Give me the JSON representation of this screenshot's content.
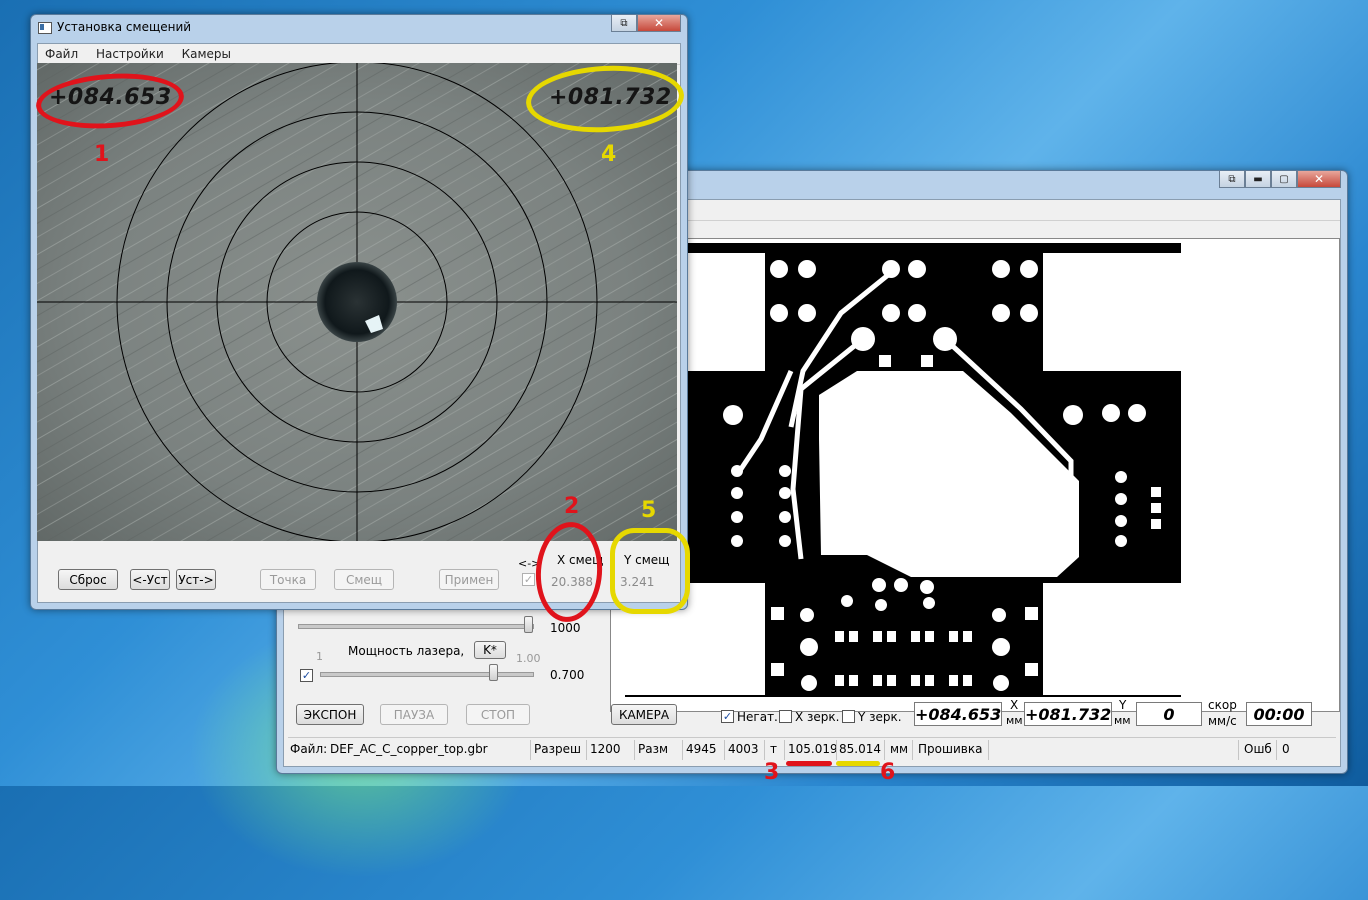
{
  "front_window": {
    "title": "Установка смещений",
    "menu": [
      "Файл",
      "Настройки",
      "Камеры"
    ],
    "camera": {
      "x_value": "+084.653",
      "y_value": "+081.732"
    },
    "buttons": {
      "reset": "Сброс",
      "set_left": "<-Уст",
      "set_right": "Уст->",
      "point": "Точка",
      "offset": "Смещ",
      "apply": "Примен"
    },
    "arrow_label": "<->",
    "x_offset": {
      "label": "X смещ",
      "value": "20.388"
    },
    "y_offset": {
      "label": "Y смещ",
      "value": "3.241"
    }
  },
  "back_window": {
    "slider1": {
      "max_label": "",
      "value": "1000"
    },
    "laser": {
      "label": "Мощность лазера,",
      "k_button": "K*",
      "min_label": "1",
      "max_label": "1.00",
      "value": "0.700"
    },
    "buttons": {
      "expose": "ЭКСПОН",
      "pause": "ПАУЗА",
      "stop": "СТОП",
      "camera": "КАМЕРА"
    },
    "checks": {
      "negative": "Негат.",
      "x_mirror": "X зерк.",
      "y_mirror": "Y зерк."
    },
    "readouts": {
      "x_value": "+084.653",
      "x_label": "X",
      "x_unit": "мм",
      "y_value": "+081.732",
      "y_label": "Y",
      "y_unit": "мм",
      "speed_value": "0",
      "speed_label_1": "скор",
      "speed_label_2": "мм/с",
      "time_value": "00:00"
    },
    "statusbar": {
      "file_label": "Файл:",
      "file_name": "DEF_AC_C_copper_top.gbr",
      "res_label": "Разреш",
      "res_value": "1200",
      "size_label": "Разм",
      "size_w": "4945",
      "size_h": "4003",
      "t_label": "т",
      "dim_x": "105.019",
      "dim_y": "85.014",
      "dim_unit": "мм",
      "firmware": "Прошивка",
      "err_label": "Ошб",
      "err_value": "0"
    }
  },
  "annotations": {
    "n1": "1",
    "n2": "2",
    "n3": "3",
    "n4": "4",
    "n5": "5",
    "n6": "6"
  },
  "colors": {
    "annot_red": "#e0131b",
    "annot_yellow": "#e6d800",
    "pcb_black": "#000000"
  }
}
